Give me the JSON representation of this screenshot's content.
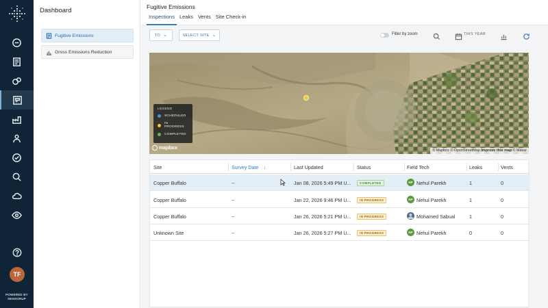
{
  "rail": {
    "powered_by": "POWERED BY",
    "brand": "SENSORUP",
    "avatar_initials": "TF",
    "avatar_color": "#b8663a"
  },
  "sidebar": {
    "title": "Dashboard",
    "items": [
      {
        "label": "Fugitive Emissions",
        "icon": "report-icon",
        "active": true
      },
      {
        "label": "Gross Emissions Reduction",
        "icon": "bar-chart-icon",
        "active": false
      }
    ]
  },
  "header": {
    "title": "Fugitive Emissions",
    "tabs": [
      {
        "label": "Inspections",
        "active": true
      },
      {
        "label": "Leaks",
        "active": false
      },
      {
        "label": "Vents",
        "active": false
      },
      {
        "label": "Site Check-in",
        "active": false
      }
    ]
  },
  "toolbar": {
    "to_label": "TO",
    "select_site_label": "SELECT SITE",
    "filter_by_zoom_label": "Filter by zoom",
    "filter_by_zoom_on": false,
    "date_range_label": "THIS YEAR"
  },
  "map": {
    "legend": {
      "title": "LEGEND",
      "items": [
        {
          "label": "SCHEDULED",
          "color": "#4a90d9"
        },
        {
          "label": "IN PROGRESS",
          "color": "#f2c337"
        },
        {
          "label": "COMPLETED",
          "color": "#5cb85c"
        }
      ]
    },
    "logo_text": "mapbox",
    "attribution": {
      "mapbox": "© Mapbox",
      "osm": "© OpenStreetMap",
      "improve": "Improve this map",
      "maxar": "© Maxar"
    }
  },
  "table": {
    "columns": {
      "site": "Site",
      "survey_date": "Survey Date",
      "last_updated": "Last Updated",
      "status": "Status",
      "field_tech": "Field Tech",
      "leaks": "Leaks",
      "vents": "Vents"
    },
    "rows": [
      {
        "site": "Copper Buffalo",
        "survey_date": "--",
        "last_updated": "Jan 08, 2026 5:49 PM U...",
        "status": "COMPLETED",
        "status_kind": "completed",
        "tech": "Nehul Parekh",
        "tech_initials": "NP",
        "leaks": "1",
        "vents": "0",
        "selected": true
      },
      {
        "site": "Copper Buffalo",
        "survey_date": "--",
        "last_updated": "Jan 22, 2026 9:46 PM U...",
        "status": "IN PROGRESS",
        "status_kind": "progress",
        "tech": "Nehul Parekh",
        "tech_initials": "NP",
        "leaks": "1",
        "vents": "0",
        "selected": false
      },
      {
        "site": "Copper Buffalo",
        "survey_date": "--",
        "last_updated": "Jan 26, 2026 5:21 PM U...",
        "status": "IN PROGRESS",
        "status_kind": "progress",
        "tech": "Mohamed Sabual",
        "tech_initials": "",
        "leaks": "1",
        "vents": "0",
        "selected": false
      },
      {
        "site": "Unknown Site",
        "survey_date": "--",
        "last_updated": "Jan 26, 2026 5:27 PM U...",
        "status": "IN PROGRESS",
        "status_kind": "progress",
        "tech": "Nehul Parekh",
        "tech_initials": "NP",
        "leaks": "0",
        "vents": "0",
        "selected": false
      }
    ]
  },
  "colors": {
    "rail_bg": "#0f2436",
    "accent": "#2c7fc4",
    "selected_row": "#e3eef7",
    "tech_avatar": "#5a9a3e"
  }
}
